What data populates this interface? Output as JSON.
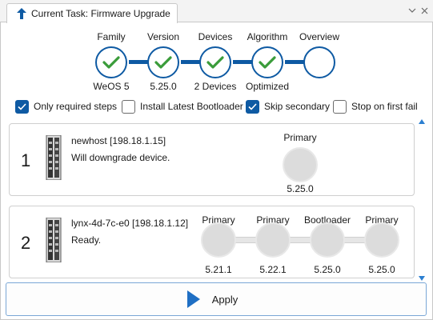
{
  "tab": {
    "title": "Current Task: Firmware Upgrade",
    "icon": "upload-arrow-icon"
  },
  "window_controls": {
    "dropdown_icon": "chevron-down-icon",
    "close_icon": "close-icon"
  },
  "stepper": {
    "steps": [
      {
        "label": "Family",
        "value": "WeOS 5",
        "done": true
      },
      {
        "label": "Version",
        "value": "5.25.0",
        "done": true
      },
      {
        "label": "Devices",
        "value": "2 Devices",
        "done": true
      },
      {
        "label": "Algorithm",
        "value": "Optimized",
        "done": true
      },
      {
        "label": "Overview",
        "value": "",
        "done": false
      }
    ]
  },
  "options": [
    {
      "label": "Only required steps",
      "checked": true
    },
    {
      "label": "Install Latest Bootloader",
      "checked": false
    },
    {
      "label": "Skip secondary",
      "checked": true
    },
    {
      "label": "Stop on first fail",
      "checked": false
    }
  ],
  "devices": [
    {
      "index": "1",
      "name": "newhost [198.18.1.15]",
      "status": "Will downgrade device.",
      "firmware_steps": [
        {
          "label": "Primary",
          "value": "5.25.0"
        }
      ]
    },
    {
      "index": "2",
      "name": "lynx-4d-7c-e0 [198.18.1.12]",
      "status": "Ready.",
      "firmware_steps": [
        {
          "label": "Primary",
          "value": "5.21.1"
        },
        {
          "label": "Primary",
          "value": "5.22.1"
        },
        {
          "label": "Bootloader",
          "value": "5.25.0"
        },
        {
          "label": "Primary",
          "value": "5.25.0"
        }
      ]
    }
  ],
  "apply": {
    "label": "Apply",
    "icon": "play-icon"
  },
  "colors": {
    "accent": "#0e5aa3",
    "check": "#3a9c3a",
    "pending": "#dcdcdc"
  }
}
